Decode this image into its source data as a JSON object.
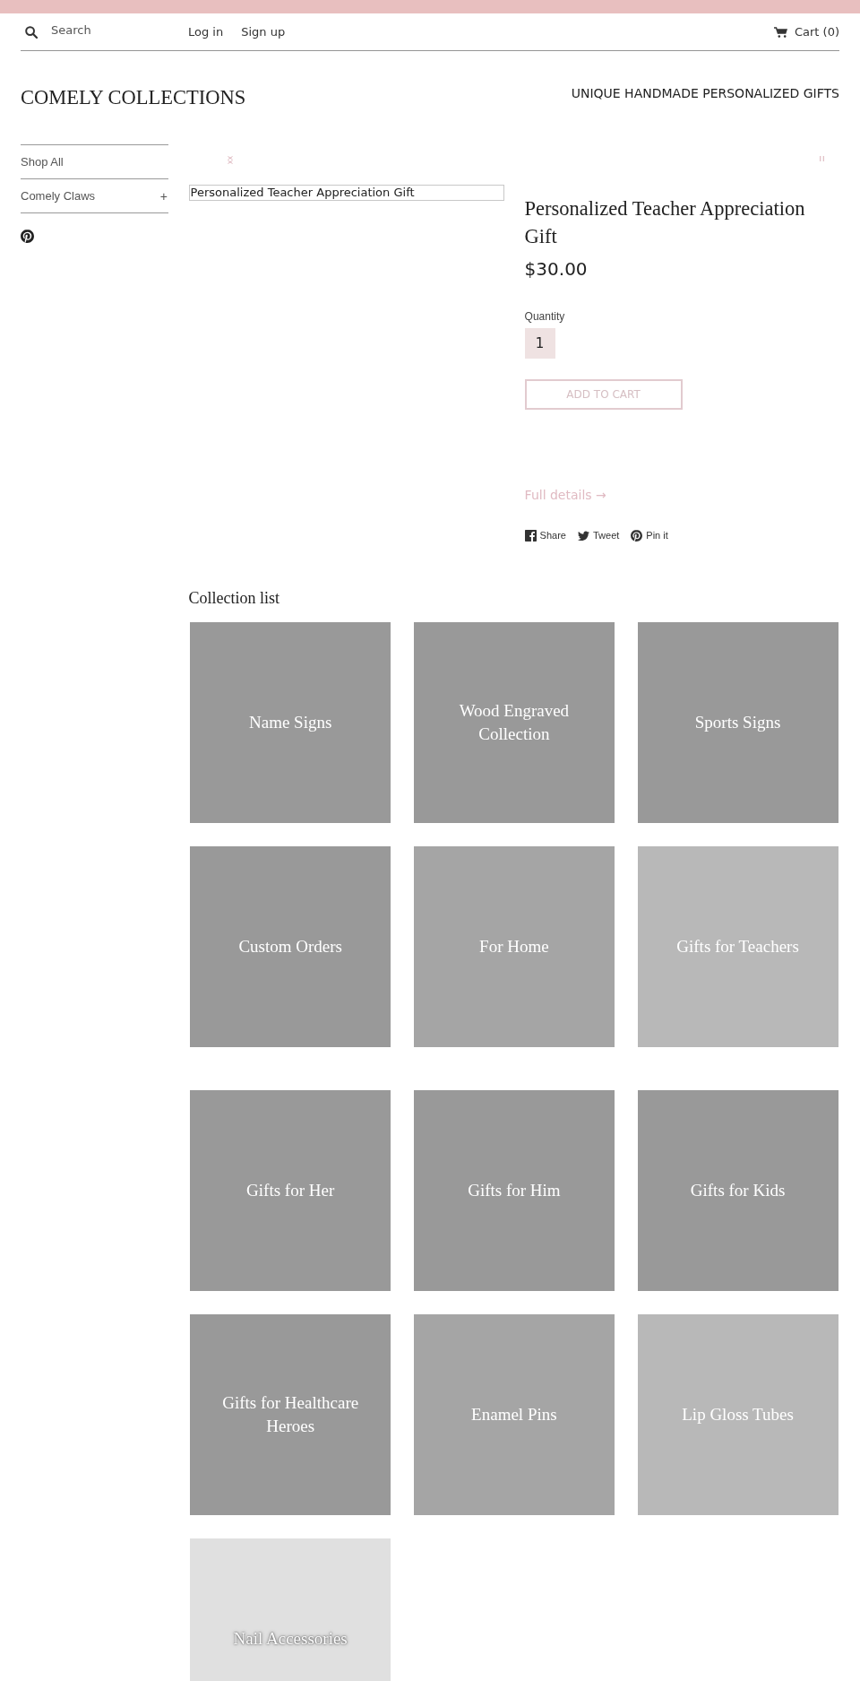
{
  "header": {
    "search": {
      "placeholder": "Search"
    },
    "account_links": [
      "Log in",
      "Sign up"
    ],
    "cart": "Cart (0)"
  },
  "branding": {
    "logo": "COMELY COLLECTIONS",
    "tagline": "UNIQUE HANDMADE PERSONALIZED GIFTS"
  },
  "sidebar": {
    "items": [
      {
        "label": "Shop All"
      },
      {
        "label": "Comely Claws",
        "toggle": "+"
      }
    ]
  },
  "product": {
    "image_alt": "Personalized Teacher Appreciation Gift",
    "title": "Personalized Teacher Appreciation Gift",
    "price": "$30.00",
    "quantity": {
      "label": "Quantity",
      "value": "1"
    },
    "add_to_cart": "ADD TO CART",
    "details_link": "Full details →",
    "share": [
      {
        "kind": "facebook",
        "label": "Share"
      },
      {
        "kind": "twitter",
        "label": "Tweet"
      },
      {
        "kind": "pinterest",
        "label": "Pin it"
      }
    ]
  },
  "collection_lists": [
    {
      "title": "Collection list",
      "collections": [
        {
          "name": "Name Signs",
          "color": "#999999"
        },
        {
          "name": "Wood Engraved Collection",
          "color": "#999999"
        },
        {
          "name": "Sports Signs",
          "color": "#999999"
        },
        {
          "name": "Custom Orders",
          "color": "#999999"
        },
        {
          "name": "For Home",
          "color": "#a5a5a5"
        },
        {
          "name": "Gifts for Teachers",
          "color": "#b8b8b8"
        }
      ]
    },
    {
      "collections": [
        {
          "name": "Gifts for Her",
          "color": "#999999"
        },
        {
          "name": "Gifts for Him",
          "color": "#999999"
        },
        {
          "name": "Gifts for Kids",
          "color": "#999999"
        },
        {
          "name": "Gifts for Healthcare Heroes",
          "color": "#999999"
        },
        {
          "name": "Enamel Pins",
          "color": "#a5a5a5"
        },
        {
          "name": "Lip Gloss Tubes",
          "color": "#b8b8b8"
        },
        {
          "name": "Nail Accessories",
          "color": "#e0e0e0"
        }
      ]
    }
  ]
}
